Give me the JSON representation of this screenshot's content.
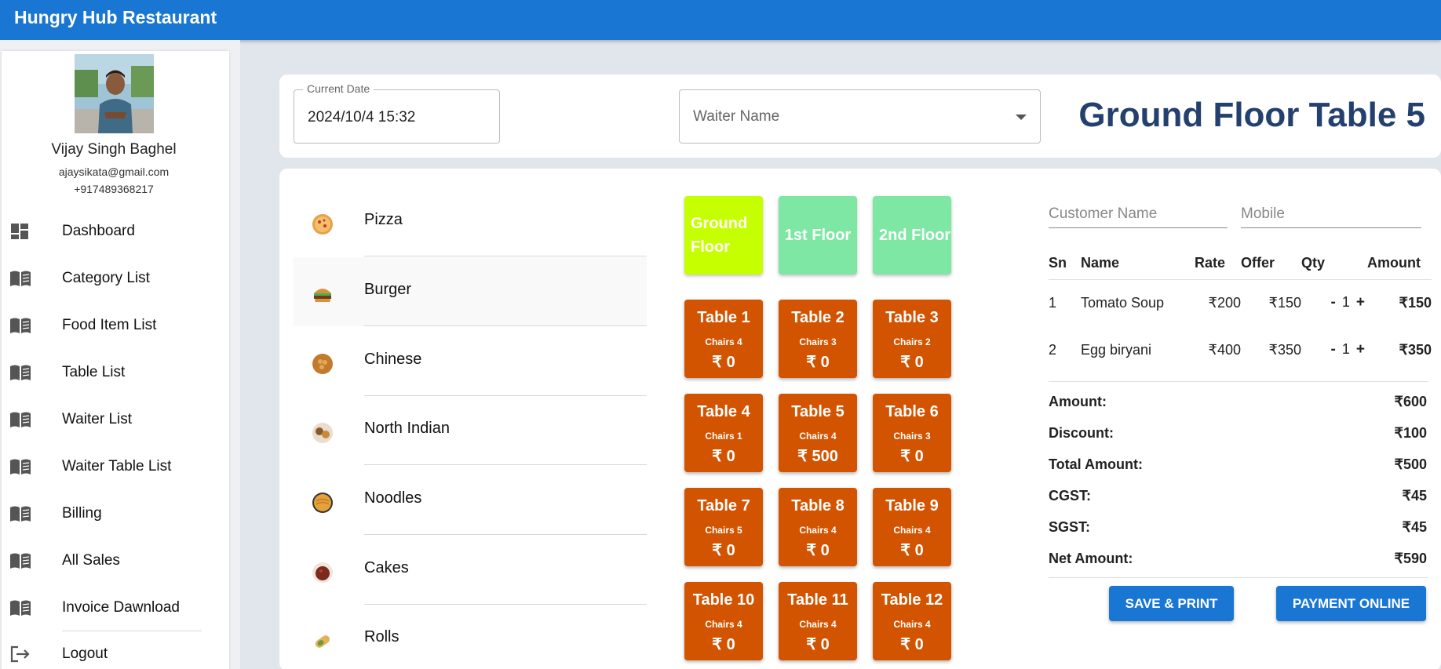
{
  "app": {
    "title": "Hungry Hub Restaurant"
  },
  "profile": {
    "name": "Vijay Singh Baghel",
    "email": "ajaysikata@gmail.com",
    "phone": "+917489368217"
  },
  "sidebar": {
    "items": [
      {
        "label": "Dashboard",
        "icon": "dashboard-icon"
      },
      {
        "label": "Category List",
        "icon": "book-icon"
      },
      {
        "label": "Food Item List",
        "icon": "book-icon"
      },
      {
        "label": "Table List",
        "icon": "book-icon"
      },
      {
        "label": "Waiter List",
        "icon": "book-icon"
      },
      {
        "label": "Waiter Table List",
        "icon": "book-icon"
      },
      {
        "label": "Billing",
        "icon": "book-icon"
      },
      {
        "label": "All Sales",
        "icon": "book-icon"
      },
      {
        "label": "Invoice Dawnload",
        "icon": "book-icon"
      },
      {
        "label": "Logout",
        "icon": "logout-icon"
      }
    ]
  },
  "header": {
    "date_label": "Current Date",
    "date_value": "2024/10/4 15:32",
    "waiter_placeholder": "Waiter Name",
    "heading": "Ground Floor Table 5"
  },
  "categories": [
    {
      "label": "Pizza",
      "icon": "pizza-icon"
    },
    {
      "label": "Burger",
      "icon": "burger-icon"
    },
    {
      "label": "Chinese",
      "icon": "chinese-food-icon"
    },
    {
      "label": "North Indian",
      "icon": "north-indian-food-icon"
    },
    {
      "label": "Noodles",
      "icon": "noodles-icon"
    },
    {
      "label": "Cakes",
      "icon": "cake-icon"
    },
    {
      "label": "Rolls",
      "icon": "roll-icon"
    }
  ],
  "floors": [
    {
      "label": "Ground Floor",
      "color": "#c6ff00"
    },
    {
      "label": "1st Floor",
      "color": "#7de7a3"
    },
    {
      "label": "2nd Floor",
      "color": "#7de7a3"
    }
  ],
  "tables": [
    {
      "name": "Table 1",
      "chairs": "Chairs 4",
      "amount": "₹ 0"
    },
    {
      "name": "Table 2",
      "chairs": "Chairs 3",
      "amount": "₹ 0"
    },
    {
      "name": "Table 3",
      "chairs": "Chairs 2",
      "amount": "₹ 0"
    },
    {
      "name": "Table 4",
      "chairs": "Chairs 1",
      "amount": "₹ 0"
    },
    {
      "name": "Table 5",
      "chairs": "Chairs 4",
      "amount": "₹ 500"
    },
    {
      "name": "Table 6",
      "chairs": "Chairs 3",
      "amount": "₹ 0"
    },
    {
      "name": "Table 7",
      "chairs": "Chairs 5",
      "amount": "₹ 0"
    },
    {
      "name": "Table 8",
      "chairs": "Chairs 4",
      "amount": "₹ 0"
    },
    {
      "name": "Table 9",
      "chairs": "Chairs 4",
      "amount": "₹ 0"
    },
    {
      "name": "Table 10",
      "chairs": "Chairs 4",
      "amount": "₹ 0"
    },
    {
      "name": "Table 11",
      "chairs": "Chairs 4",
      "amount": "₹ 0"
    },
    {
      "name": "Table 12",
      "chairs": "Chairs 4",
      "amount": "₹ 0"
    }
  ],
  "order": {
    "customer_placeholder": "Customer Name",
    "mobile_placeholder": "Mobile",
    "columns": {
      "sn": "Sn",
      "name": "Name",
      "rate": "Rate",
      "offer": "Offer",
      "qty": "Qty",
      "amount": "Amount"
    },
    "rows": [
      {
        "sn": "1",
        "name": "Tomato Soup",
        "rate": "₹200",
        "offer": "₹150",
        "qty": "1",
        "amount": "₹150"
      },
      {
        "sn": "2",
        "name": "Egg biryani",
        "rate": "₹400",
        "offer": "₹350",
        "qty": "1",
        "amount": "₹350"
      }
    ],
    "minus": "-",
    "plus": "+"
  },
  "totals": [
    {
      "label": "Amount:",
      "value": "₹600"
    },
    {
      "label": "Discount:",
      "value": "₹100"
    },
    {
      "label": "Total Amount:",
      "value": "₹500"
    },
    {
      "label": "CGST:",
      "value": "₹45"
    },
    {
      "label": "SGST:",
      "value": "₹45"
    },
    {
      "label": "Net Amount:",
      "value": "₹590"
    }
  ],
  "actions": {
    "save_print": "SAVE & PRINT",
    "payment_online": "PAYMENT ONLINE"
  },
  "colors": {
    "primary": "#1976d2",
    "table": "#d35400",
    "heading": "#23406e"
  }
}
